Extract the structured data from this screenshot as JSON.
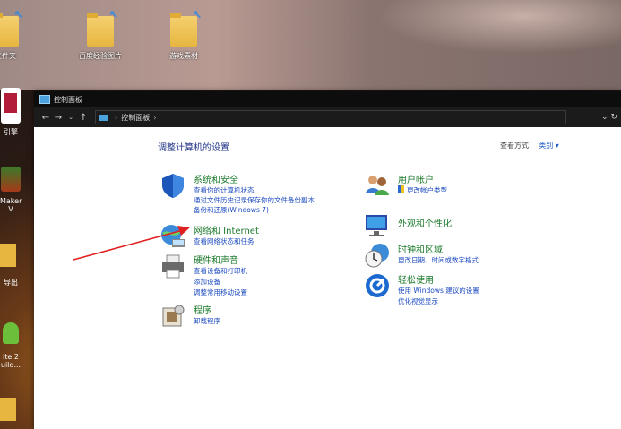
{
  "desktop": {
    "icons": [
      {
        "label": "文件夹"
      },
      {
        "label": "百度经验图片"
      },
      {
        "label": "游戏素材"
      }
    ],
    "side_apps": [
      {
        "label": "引擎"
      },
      {
        "label": "Maker"
      },
      {
        "label": "V"
      },
      {
        "label": "导出"
      },
      {
        "label": "ite 2"
      },
      {
        "label": "uild..."
      }
    ]
  },
  "window": {
    "title": "控制面板",
    "address": {
      "breadcrumb": "控制面板"
    },
    "page_title": "调整计算机的设置",
    "view_by_label": "查看方式:",
    "view_by_value": "类别 ▾",
    "categories_left": [
      {
        "head": "系统和安全",
        "links": [
          "查看你的计算机状态",
          "通过文件历史记录保存你的文件备份副本",
          "备份和还原(Windows 7)"
        ]
      },
      {
        "head": "网络和 Internet",
        "links": [
          "查看网络状态和任务"
        ]
      },
      {
        "head": "硬件和声音",
        "links": [
          "查看设备和打印机",
          "添加设备",
          "调整常用移动设置"
        ]
      },
      {
        "head": "程序",
        "links": [
          "卸载程序"
        ]
      }
    ],
    "categories_right": [
      {
        "head": "用户帐户",
        "links": [
          "更改帐户类型"
        ]
      },
      {
        "head": "外观和个性化",
        "links": []
      },
      {
        "head": "时钟和区域",
        "links": [
          "更改日期、时间或数字格式"
        ]
      },
      {
        "head": "轻松使用",
        "links": [
          "使用 Windows 建议的设置",
          "优化视觉显示"
        ]
      }
    ]
  }
}
